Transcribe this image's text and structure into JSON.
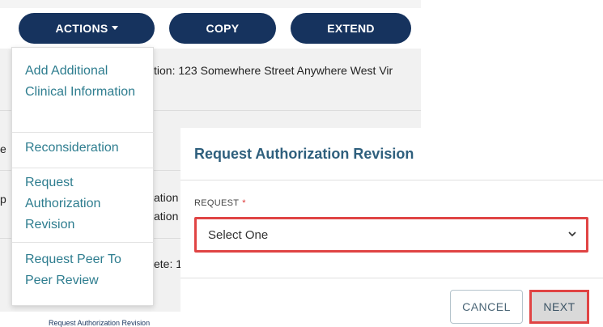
{
  "toolbar": {
    "actions_label": "ACTIONS",
    "copy_label": "COPY",
    "extend_label": "EXTEND"
  },
  "background": {
    "location_text": "tion: 123 Somewhere Street Anywhere West Vir",
    "frag_a": "ation",
    "frag_b": "ation",
    "frag_c": "ete: 1",
    "frag_edge_1": "e",
    "frag_edge_2": "p",
    "bottom_link": "Request Authorization Revision"
  },
  "actions_menu": {
    "items": [
      {
        "label": "Add Additional Clinical Information"
      },
      {
        "label": "Reconsideration"
      },
      {
        "label": "Request Authorization Revision"
      },
      {
        "label": "Request Peer To Peer Review"
      }
    ]
  },
  "modal": {
    "title": "Request Authorization Revision",
    "request_label": "REQUEST",
    "required_marker": "*",
    "request_value": "Select One",
    "cancel_label": "CANCEL",
    "next_label": "NEXT"
  },
  "colors": {
    "navy": "#16335e",
    "teal_link": "#2e7d8f",
    "highlight_red": "#e04444"
  }
}
